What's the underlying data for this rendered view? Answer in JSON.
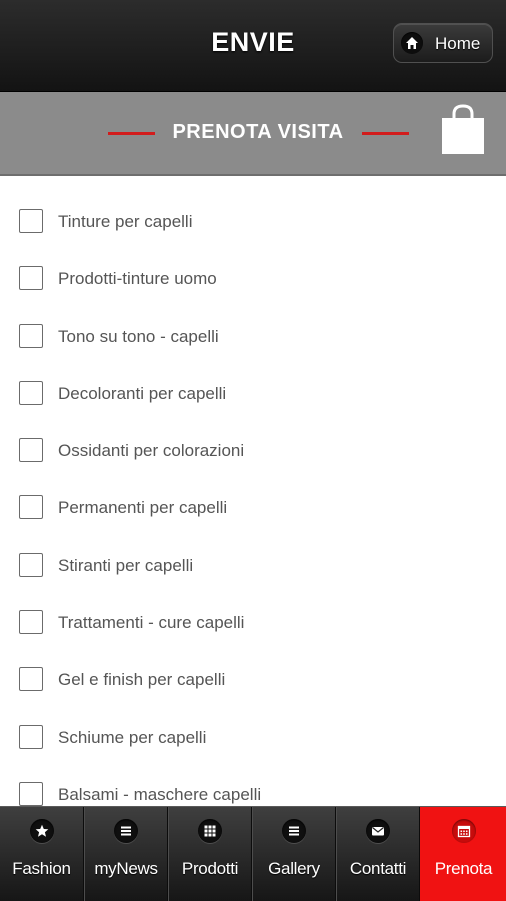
{
  "header": {
    "title": "ENVIE",
    "home_label": "Home",
    "home_icon": "home-icon"
  },
  "section": {
    "title": "PRENOTA VISITA",
    "accent_color": "#d21c1c",
    "bag_icon": "shopping-bag-icon"
  },
  "list": {
    "items": [
      {
        "label": "Tinture per capelli",
        "checked": false
      },
      {
        "label": "Prodotti-tinture uomo",
        "checked": false
      },
      {
        "label": "Tono su tono - capelli",
        "checked": false
      },
      {
        "label": "Decoloranti per capelli",
        "checked": false
      },
      {
        "label": "Ossidanti per colorazioni",
        "checked": false
      },
      {
        "label": "Permanenti per capelli",
        "checked": false
      },
      {
        "label": "Stiranti per capelli",
        "checked": false
      },
      {
        "label": "Trattamenti - cure capelli",
        "checked": false
      },
      {
        "label": "Gel e finish per capelli",
        "checked": false
      },
      {
        "label": "Schiume per capelli",
        "checked": false
      },
      {
        "label": "Balsami - maschere capelli",
        "checked": false
      }
    ]
  },
  "tabbar": {
    "active_color": "#f01212",
    "tabs": [
      {
        "label": "Fashion",
        "icon": "star-icon",
        "active": false
      },
      {
        "label": "myNews",
        "icon": "list-icon",
        "active": false
      },
      {
        "label": "Prodotti",
        "icon": "grid-icon",
        "active": false
      },
      {
        "label": "Gallery",
        "icon": "list-icon",
        "active": false
      },
      {
        "label": "Contatti",
        "icon": "mail-icon",
        "active": false
      },
      {
        "label": "Prenota",
        "icon": "calendar-icon",
        "active": true
      }
    ]
  }
}
